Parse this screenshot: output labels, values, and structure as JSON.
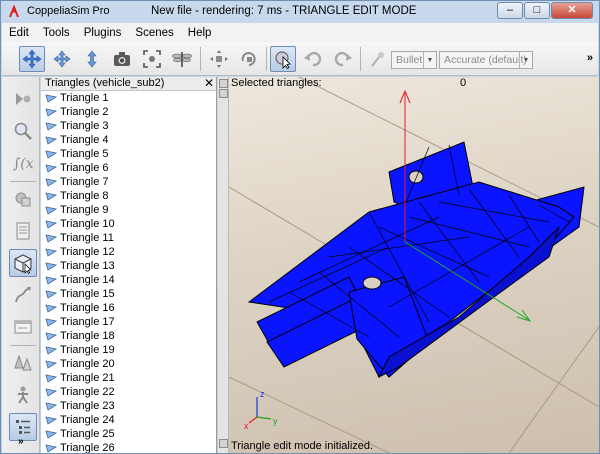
{
  "window": {
    "app_name": "CoppeliaSim Pro",
    "title": "New file - rendering: 7 ms - TRIANGLE EDIT MODE",
    "minimize": "–",
    "maximize": "□",
    "close": "✕"
  },
  "menubar": {
    "items": [
      {
        "label": "Edit"
      },
      {
        "label": "Tools"
      },
      {
        "label": "Plugins"
      },
      {
        "label": "Scenes"
      },
      {
        "label": "Help"
      }
    ]
  },
  "toolbar": {
    "engine": "Bullet",
    "accuracy": "Accurate (default)",
    "more": "»"
  },
  "panel": {
    "title": "Triangles (vehicle_sub2)",
    "close": "✕",
    "items": [
      "Triangle 1",
      "Triangle 2",
      "Triangle 3",
      "Triangle 4",
      "Triangle 5",
      "Triangle 6",
      "Triangle 7",
      "Triangle 8",
      "Triangle 9",
      "Triangle 10",
      "Triangle 11",
      "Triangle 12",
      "Triangle 13",
      "Triangle 14",
      "Triangle 15",
      "Triangle 16",
      "Triangle 17",
      "Triangle 18",
      "Triangle 19",
      "Triangle 20",
      "Triangle 21",
      "Triangle 22",
      "Triangle 23",
      "Triangle 24",
      "Triangle 25",
      "Triangle 26"
    ]
  },
  "viewport": {
    "selected_label": "Selected triangles:",
    "selected_count": "0",
    "status": "Triangle edit mode initialized.",
    "axis_x": "x",
    "axis_y": "y",
    "axis_z": "z"
  },
  "left_tools": {
    "more": "»"
  },
  "colors": {
    "mesh": "#0a14ff",
    "edit_accent": "#b8cce6",
    "axis_x": "#e02020",
    "axis_y": "#1fa51f",
    "axis_z": "#1a36e0"
  }
}
